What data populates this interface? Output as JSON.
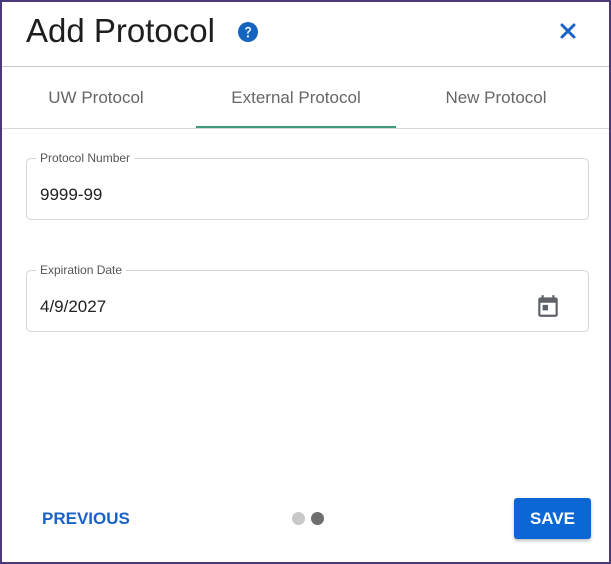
{
  "dialog": {
    "title": "Add Protocol",
    "help_icon": "question-circle-icon",
    "close_icon": "close-icon"
  },
  "tabs": [
    {
      "label": "UW Protocol",
      "active": false
    },
    {
      "label": "External Protocol",
      "active": true
    },
    {
      "label": "New Protocol",
      "active": false
    }
  ],
  "form": {
    "protocol_number": {
      "label": "Protocol Number",
      "value": "9999-99"
    },
    "expiration_date": {
      "label": "Expiration Date",
      "value": "4/9/2027",
      "icon": "calendar-icon"
    }
  },
  "footer": {
    "previous_label": "PREVIOUS",
    "save_label": "SAVE",
    "steps_total": 2,
    "current_step": 2
  },
  "colors": {
    "accent_blue": "#1a63c6",
    "save_bg": "#0b66d6",
    "tab_indicator": "#3f9a7c",
    "help_icon": "#1565c0",
    "dot_inactive": "#c8c8c8",
    "dot_active": "#6e6e6e",
    "dialog_border": "#4a3a7a"
  }
}
